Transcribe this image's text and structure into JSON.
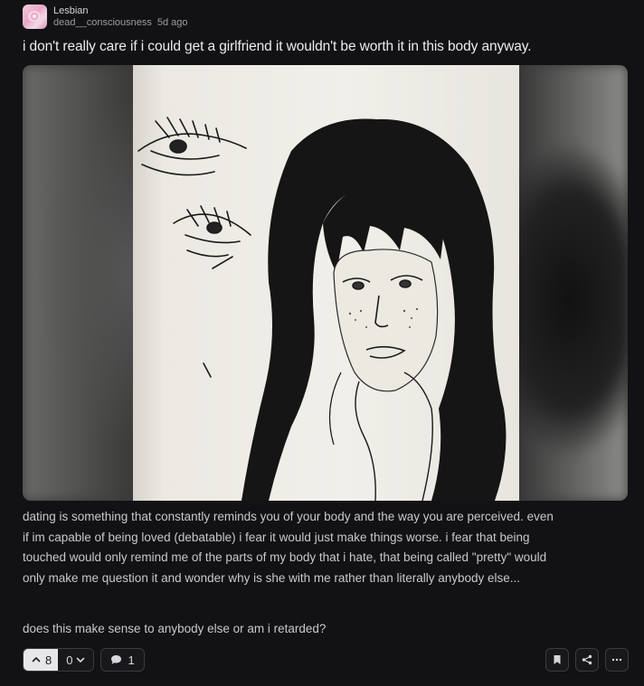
{
  "post": {
    "community": "Lesbian",
    "author": "dead__consciousness",
    "age": "5d ago",
    "title": "i don't really care if i could get a girlfriend it wouldn't be worth it in this body anyway.",
    "body": "dating is something that constantly reminds you of your body and the way you are perceived. even if im capable of being loved (debatable) i fear it would just make things worse. i fear that being touched would only remind me of the parts of my body that i hate, that being called \"pretty\" would only make me question it and wonder why is she with me rather than literally anybody else...",
    "question": "does this make sense to anybody else or am i retarded?"
  },
  "actions": {
    "upvotes": "8",
    "downvotes": "0",
    "comments": "1"
  },
  "icons": {
    "upvote": "chevron-up-icon",
    "downvote": "chevron-down-icon",
    "comment": "comment-icon",
    "bookmark": "bookmark-icon",
    "share": "share-icon",
    "more": "more-icon"
  }
}
